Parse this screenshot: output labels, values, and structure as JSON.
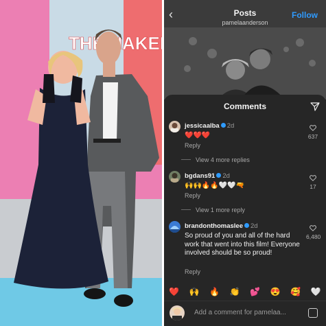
{
  "left_photo": {
    "poster_text": "THE NAKED G"
  },
  "post": {
    "title": "Posts",
    "username": "pamelaanderson",
    "follow_label": "Follow"
  },
  "comments_sheet": {
    "title": "Comments",
    "items": [
      {
        "username": "jessicaalba",
        "time": "2d",
        "text": "❤️❤️❤️",
        "reply_label": "Reply",
        "likes": "637",
        "view_more": "View 4 more replies"
      },
      {
        "username": "bgdans91",
        "time": "2d",
        "text": "🙌🙌🔥🔥🤍🤍🔫",
        "reply_label": "Reply",
        "likes": "17",
        "view_more": "View 1 more reply"
      },
      {
        "username": "brandonthomaslee",
        "time": "2d",
        "text": "So proud of you and all of the hard work that went into this film! Everyone involved should be so proud!",
        "reply_label": "Reply",
        "likes": "6,480"
      }
    ],
    "emoji_bar": [
      "❤️",
      "🙌",
      "🔥",
      "👏",
      "💕",
      "😍",
      "🥰",
      "🤍"
    ],
    "add_comment_placeholder": "Add a comment for pamelaa..."
  },
  "colors": {
    "accent": "#2f9bff",
    "heart": "#e0245e",
    "sheet_bg": "#262626"
  },
  "icons": [
    "back-chevron-icon",
    "share-send-icon",
    "heart-outline-icon",
    "verified-badge-icon",
    "gif-sticker-icon"
  ]
}
